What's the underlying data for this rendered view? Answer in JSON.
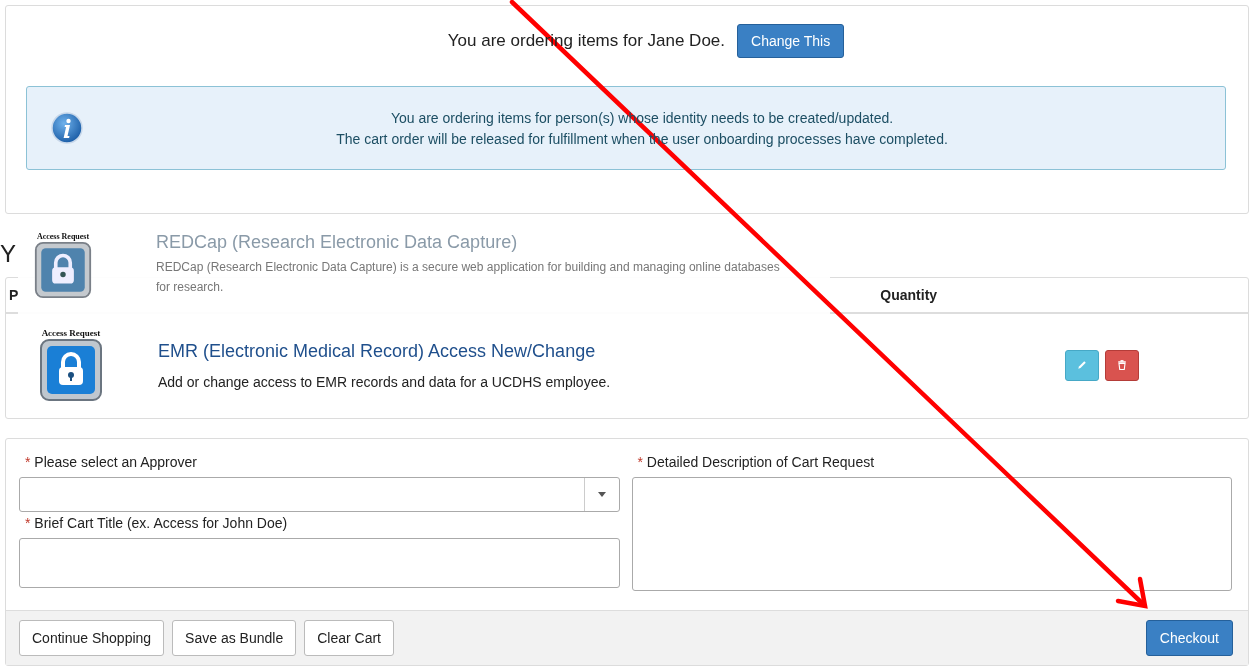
{
  "header": {
    "text": "You are ordering items for Jane Doe.",
    "button": "Change This"
  },
  "notice": {
    "lines": [
      "You are ordering items for person(s) whose identity needs to be created/updated.",
      "The cart order will be released for fulfillment when the user onboarding processes have completed."
    ]
  },
  "cart": {
    "heading": "Y",
    "columns": [
      "P",
      "Quantity"
    ],
    "items": [
      {
        "caption": "Access Request",
        "title": "EMR (Electronic Medical Record) Access New/Change",
        "description": "Add or change access to EMR records and data for a UCDHS employee.",
        "actions": [
          {
            "kind": "edit"
          },
          {
            "kind": "delete"
          }
        ]
      }
    ]
  },
  "dragged_item": {
    "caption": "Access Request",
    "title": "REDCap (Research Electronic Data Capture)",
    "description": "REDCap (Research Electronic Data Capture) is a secure web application for building and managing online databases for research."
  },
  "form": {
    "columns": [
      [
        {
          "kind": "select",
          "required_mark": "*",
          "label": "Please select an Approver"
        },
        {
          "kind": "text",
          "required_mark": "*",
          "label": "Brief Cart Title (ex. Access for John Doe)"
        }
      ],
      [
        {
          "kind": "textarea",
          "required_mark": "*",
          "label": "Detailed Description of Cart Request"
        }
      ]
    ]
  },
  "footer": {
    "buttons": [
      {
        "label": "Continue Shopping",
        "kind": "default"
      },
      {
        "label": "Save as Bundle",
        "kind": "default"
      },
      {
        "label": "Clear Cart",
        "kind": "default"
      },
      {
        "label": "Checkout",
        "kind": "primary"
      }
    ]
  }
}
